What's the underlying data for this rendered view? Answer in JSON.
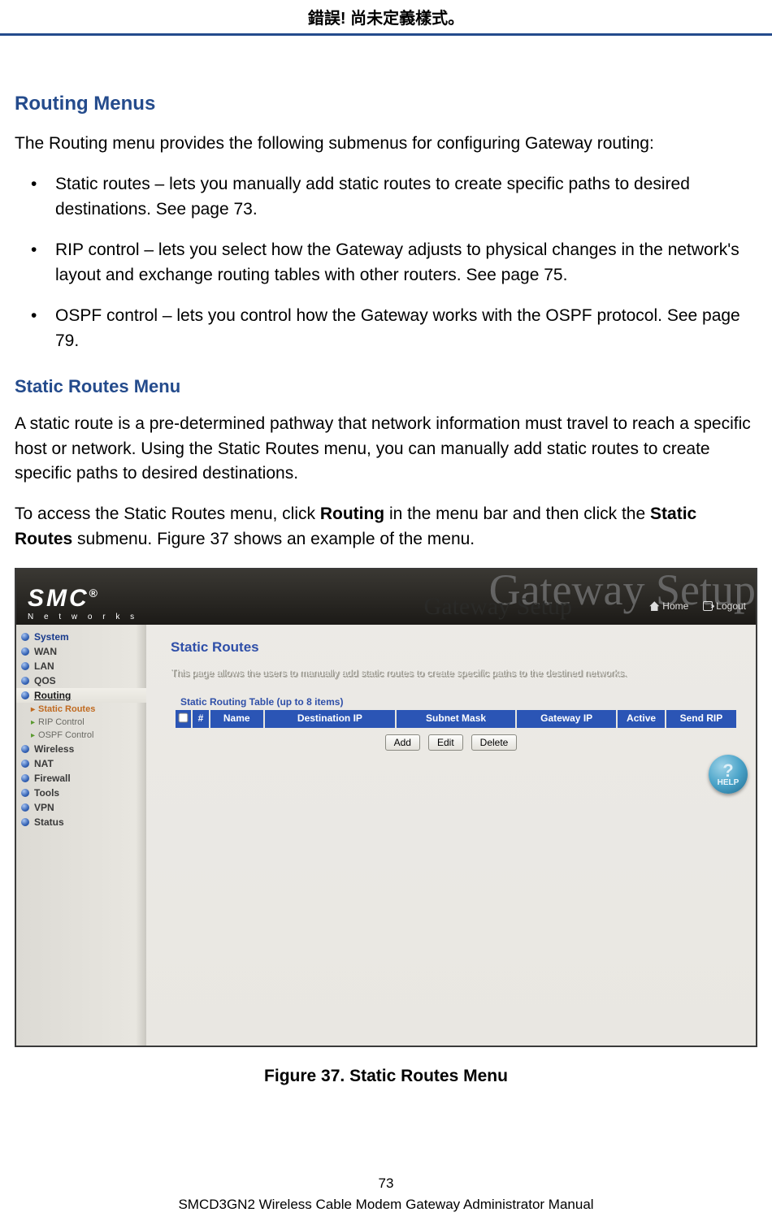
{
  "header_error": "錯誤! 尚未定義樣式。",
  "h_routing_menus": "Routing Menus",
  "p_intro": "The Routing menu provides the following submenus for configuring Gateway routing:",
  "bullets": {
    "b1": "Static routes – lets you manually add static routes to create specific paths to desired destinations. See page 73.",
    "b2": "RIP control – lets you select how the Gateway adjusts to physical changes in the network's layout and exchange routing tables with other routers. See page 75.",
    "b3": "OSPF control – lets you control how the Gateway works with the OSPF protocol. See page 79."
  },
  "h_static_routes": "Static Routes Menu",
  "p_static_1": " A static route is a pre-determined pathway that network information must travel to reach a specific host or network. Using the Static Routes menu, you can manually add static routes to create specific paths to desired destinations.",
  "p_static_2_pre": "To access the Static Routes menu, click ",
  "p_static_2_b1": "Routing",
  "p_static_2_mid": " in the menu bar and then click the ",
  "p_static_2_b2": "Static Routes",
  "p_static_2_post": " submenu. Figure 37 shows an example of the menu.",
  "screenshot": {
    "logo_main": "SMC",
    "logo_reg": "®",
    "logo_sub": "N e t w o r k s",
    "title_ghost": "Gateway Setup",
    "title_sub": "Gateway Setup",
    "links": {
      "home": "Home",
      "logout": "Logout"
    },
    "nav": {
      "system": "System",
      "wan": "WAN",
      "lan": "LAN",
      "qos": "QOS",
      "routing": "Routing",
      "static_routes": "Static Routes",
      "rip_control": "RIP Control",
      "ospf_control": "OSPF Control",
      "wireless": "Wireless",
      "nat": "NAT",
      "firewall": "Firewall",
      "tools": "Tools",
      "vpn": "VPN",
      "status": "Status"
    },
    "panel": {
      "title": "Static Routes",
      "desc": "This page allows the users to manually add static routes to create specific paths to the destined networks.",
      "table_caption": "Static Routing Table (up to 8 items)",
      "cols": {
        "num": "#",
        "name": "Name",
        "dip": "Destination IP",
        "mask": "Subnet Mask",
        "gip": "Gateway IP",
        "active": "Active",
        "rip": "Send RIP"
      },
      "buttons": {
        "add": "Add",
        "edit": "Edit",
        "delete": "Delete"
      }
    },
    "help": {
      "q": "?",
      "label": "HELP"
    }
  },
  "fig_caption": "Figure 37. Static Routes Menu",
  "footer": {
    "page_number": "73",
    "doc_title": "SMCD3GN2 Wireless Cable Modem Gateway Administrator Manual"
  }
}
